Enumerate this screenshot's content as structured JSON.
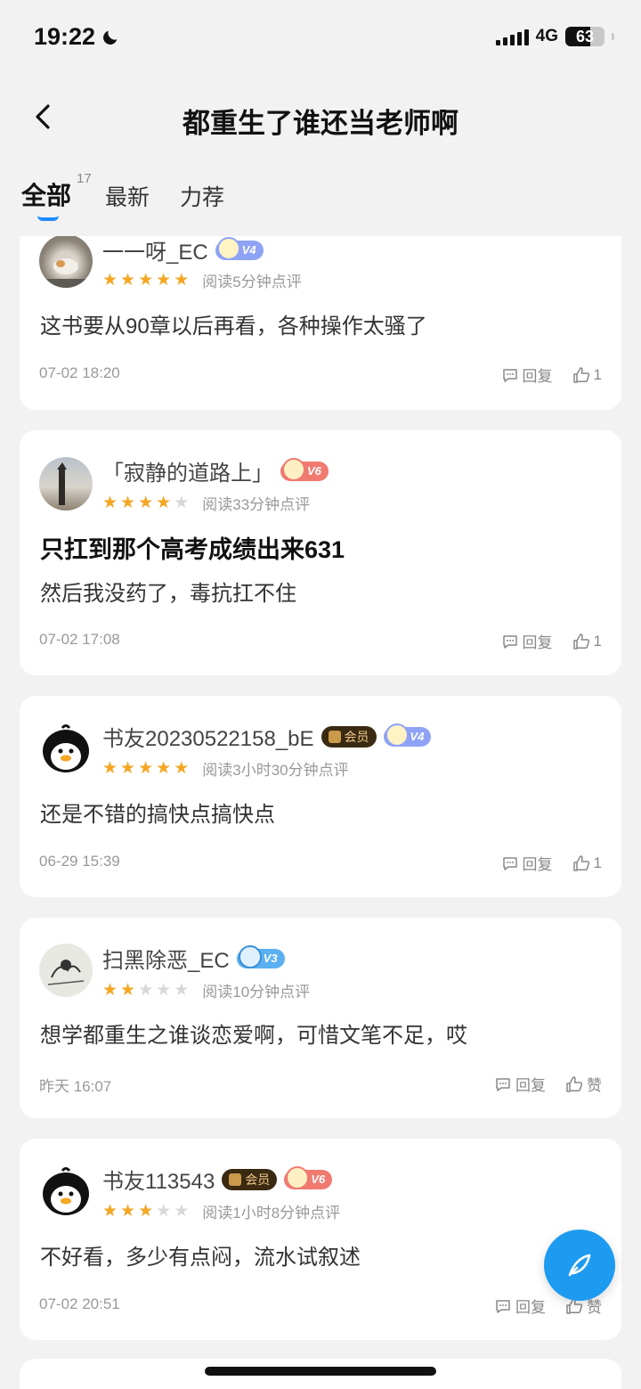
{
  "status": {
    "time": "19:22",
    "network": "4G",
    "battery": "63",
    "battery_level": 0.63
  },
  "nav": {
    "title": "都重生了谁还当老师啊"
  },
  "tabs": [
    {
      "label": "全部",
      "count": "17"
    },
    {
      "label": "最新"
    },
    {
      "label": "力荐"
    }
  ],
  "comments": [
    {
      "username": "一一呀_EC",
      "level": "V4",
      "level_color": "#8ea3f5",
      "member": "",
      "stars": 5,
      "read_time": "阅读5分钟点评",
      "title": "",
      "content": "这书要从90章以后再看，各种操作太骚了",
      "date": "07-02 18:20",
      "reply": "回复",
      "likes": "1",
      "avatar": "photo-cat"
    },
    {
      "username": "「寂静的道路上」",
      "level": "V6",
      "level_color": "#f07a70",
      "member": "",
      "stars": 4,
      "read_time": "阅读33分钟点评",
      "title": "只扛到那个高考成绩出来631",
      "content": "然后我没药了，毒抗扛不住",
      "date": "07-02 17:08",
      "reply": "回复",
      "likes": "1",
      "avatar": "photo-road"
    },
    {
      "username": "书友20230522158_bE",
      "level": "V4",
      "level_color": "#8ea3f5",
      "member": "会员",
      "stars": 5,
      "read_time": "阅读3小时30分钟点评",
      "title": "",
      "content": "还是不错的搞快点搞快点",
      "date": "06-29 15:39",
      "reply": "回复",
      "likes": "1",
      "avatar": "penguin"
    },
    {
      "username": "扫黑除恶_EC",
      "level": "V3",
      "level_color": "#5ab0f0",
      "member": "",
      "stars": 2,
      "read_time": "阅读10分钟点评",
      "title": "",
      "content": "想学都重生之谁谈恋爱啊，可惜文笔不足，哎",
      "date": "昨天 16:07",
      "reply": "回复",
      "likes": "赞",
      "avatar": "sketch"
    },
    {
      "username": "书友113543",
      "level": "V6",
      "level_color": "#f07a70",
      "member": "会员",
      "stars": 3,
      "read_time": "阅读1小时8分钟点评",
      "title": "",
      "content": "不好看，多少有点闷，流水试叙述",
      "date": "07-02 20:51",
      "reply": "回复",
      "likes": "赞",
      "avatar": "penguin"
    }
  ]
}
